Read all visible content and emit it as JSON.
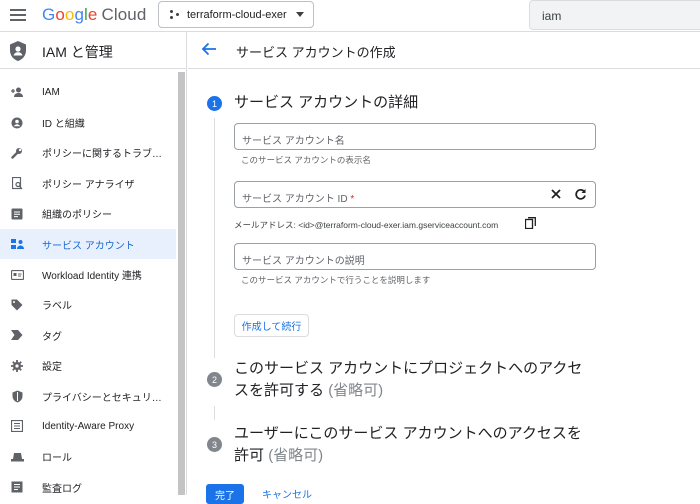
{
  "topbar": {
    "logo_letters": [
      "G",
      "o",
      "o",
      "g",
      "l",
      "e"
    ],
    "logo_cloud": "Cloud",
    "project": "terraform-cloud-exer",
    "search_value": "iam"
  },
  "sidebar": {
    "title": "IAM と管理",
    "items": [
      {
        "label": "IAM",
        "icon": "add-person-icon"
      },
      {
        "label": "ID と組織",
        "icon": "account-circle-icon"
      },
      {
        "label": "ポリシーに関するトラブ…",
        "icon": "wrench-icon"
      },
      {
        "label": "ポリシー アナライザ",
        "icon": "document-search-icon"
      },
      {
        "label": "組織のポリシー",
        "icon": "list-document-icon"
      },
      {
        "label": "サービス アカウント",
        "icon": "service-account-icon",
        "active": true
      },
      {
        "label": "Workload Identity 連携",
        "icon": "id-card-icon"
      },
      {
        "label": "ラベル",
        "icon": "tag-icon"
      },
      {
        "label": "タグ",
        "icon": "chevron-tag-icon"
      },
      {
        "label": "設定",
        "icon": "gear-icon"
      },
      {
        "label": "プライバシーとセキュリ…",
        "icon": "shield-icon"
      },
      {
        "label": "Identity-Aware Proxy",
        "icon": "proxy-icon"
      },
      {
        "label": "ロール",
        "icon": "hat-icon"
      },
      {
        "label": "監査ログ",
        "icon": "log-icon"
      }
    ]
  },
  "main": {
    "page_title": "サービス アカウントの作成",
    "steps": [
      {
        "num": "1",
        "title": "サービス アカウントの詳細"
      },
      {
        "num": "2",
        "title_line1": "このサービス アカウントにプロジェクトへのアクセ",
        "title_line2": "スを許可する",
        "optional": "(省略可)"
      },
      {
        "num": "3",
        "title_line1": "ユーザーにこのサービス アカウントへのアクセスを",
        "title_line2": "許可",
        "optional": "(省略可)"
      }
    ],
    "name_placeholder": "サービス アカウント名",
    "name_hint": "このサービス アカウントの表示名",
    "id_label": "サービス アカウント ID",
    "id_required": "*",
    "email_text": "メールアドレス: <id>@terraform-cloud-exer.iam.gserviceaccount.com",
    "desc_placeholder": "サービス アカウントの説明",
    "desc_hint": "このサービス アカウントで行うことを説明します",
    "create_continue": "作成して続行",
    "done": "完了",
    "cancel": "キャンセル"
  },
  "colors": {
    "accent": "#1a73e8",
    "active_bg": "#e8f0fe",
    "required": "#d93025"
  }
}
